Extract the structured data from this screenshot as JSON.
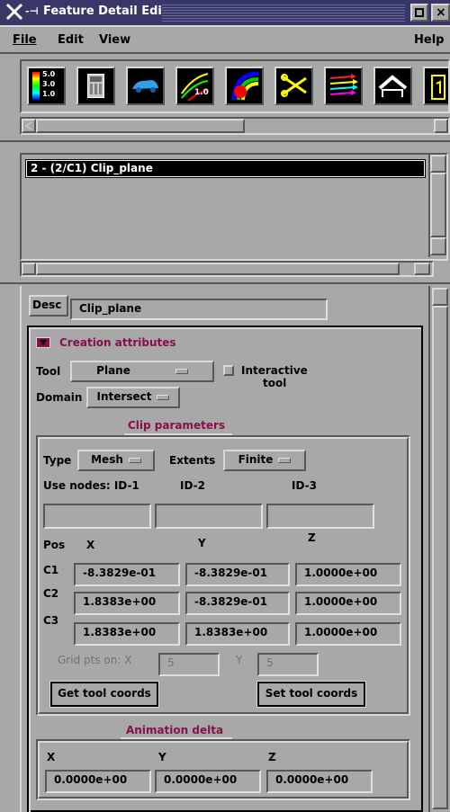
{
  "window": {
    "title": "Feature Detail Editor (Clips)",
    "title_icon": "x-logo-icon",
    "maximize_icon": "maximize-icon",
    "close_icon": "close-icon"
  },
  "menubar": {
    "file": "File",
    "edit": "Edit",
    "view": "View",
    "help": "Help"
  },
  "toolbar": {
    "icons": [
      "legend-colormap-icon",
      "calculator-icon",
      "car-model-icon",
      "contour-line-icon",
      "isosurface-icon",
      "clip-scissors-icon",
      "streamline-icon",
      "profile-icon",
      "readout-icon"
    ],
    "colormap_values": [
      "5.0",
      "3.0",
      "1.0"
    ],
    "contour_value": "1.0"
  },
  "feature_list": {
    "items": [
      "2 - (2/C1) Clip_plane"
    ],
    "selected": 0
  },
  "desc": {
    "label": "Desc",
    "value": "Clip_plane"
  },
  "creation": {
    "header": "Creation attributes",
    "tool_label": "Tool",
    "tool_value": "Plane",
    "interactive_label_1": "Interactive",
    "interactive_label_2": "tool",
    "domain_label": "Domain",
    "domain_value": "Intersect"
  },
  "clip_params": {
    "title": "Clip parameters",
    "type_label": "Type",
    "type_value": "Mesh",
    "extents_label": "Extents",
    "extents_value": "Finite",
    "use_nodes_label": "Use nodes: ID-1",
    "id2_label": "ID-2",
    "id3_label": "ID-3",
    "id_values": [
      "",
      "",
      ""
    ],
    "pos_label": "Pos",
    "x_header": "X",
    "y_header": "Y",
    "z_header": "Z",
    "rows": [
      {
        "label": "C1",
        "x": "-8.3829e-01",
        "y": "-8.3829e-01",
        "z": "1.0000e+00"
      },
      {
        "label": "C2",
        "x": "1.8383e+00",
        "y": "-8.3829e-01",
        "z": "1.0000e+00"
      },
      {
        "label": "C3",
        "x": "1.8383e+00",
        "y": "1.8383e+00",
        "z": "1.0000e+00"
      }
    ],
    "grid_label": "Grid pts on: X",
    "grid_x": "5",
    "grid_y_label": "Y",
    "grid_y": "5",
    "get_coords": "Get tool coords",
    "set_coords": "Set tool coords"
  },
  "animation": {
    "title": "Animation delta",
    "x_label": "X",
    "y_label": "Y",
    "z_label": "Z",
    "x": "0.0000e+00",
    "y": "0.0000e+00",
    "z": "0.0000e+00"
  },
  "colors": {
    "titlebar": "#383868",
    "panel": "#a8a8a8",
    "selection": "#000000",
    "accent": "#881048"
  }
}
